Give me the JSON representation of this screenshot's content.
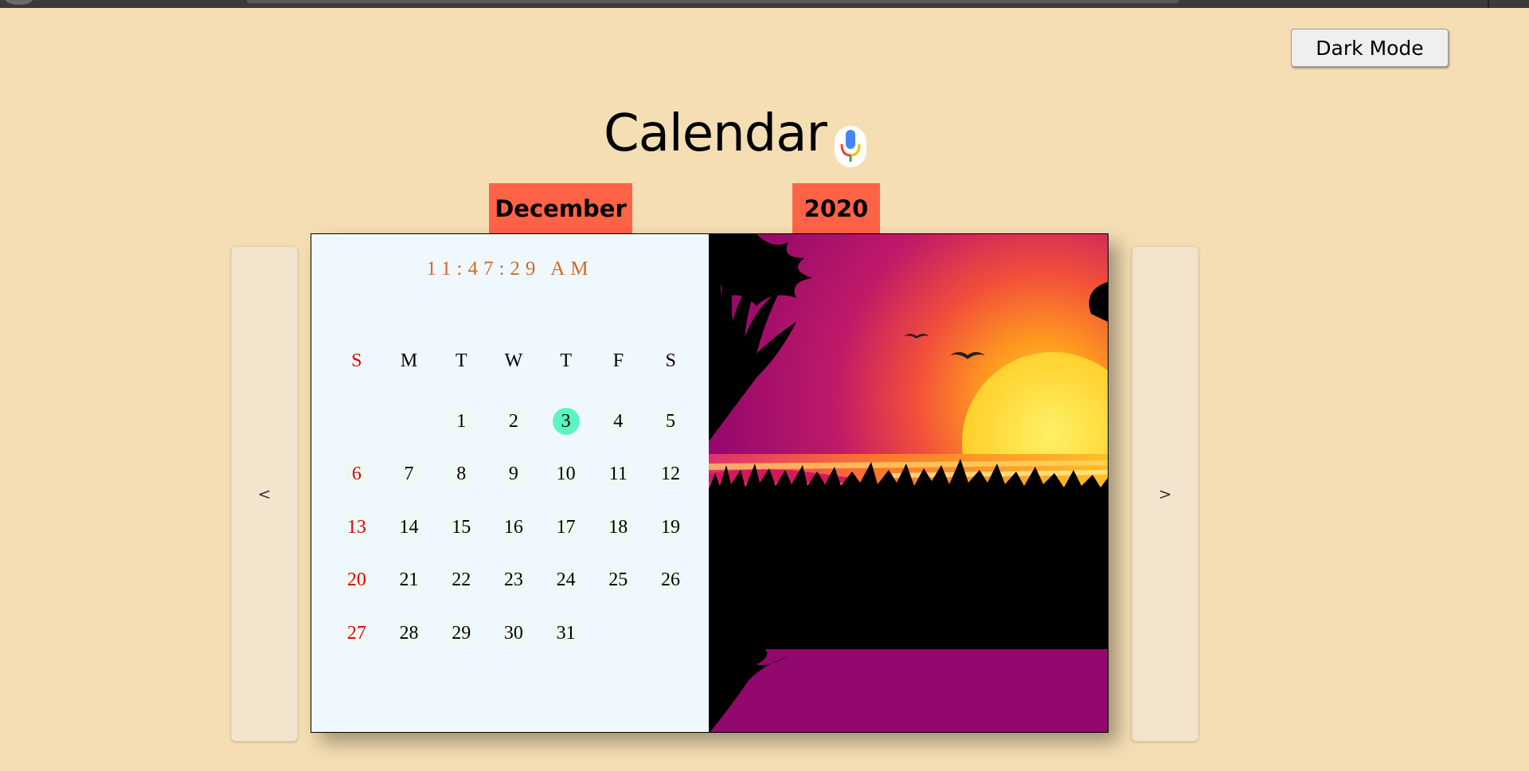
{
  "app": {
    "title": "Calendar",
    "dark_mode_label": "Dark Mode"
  },
  "header": {
    "month": "December",
    "year": "2020"
  },
  "clock": "11:47:29 AM",
  "nav": {
    "prev_label": "<",
    "next_label": ">"
  },
  "weekdays": [
    "S",
    "M",
    "T",
    "W",
    "T",
    "F",
    "S"
  ],
  "calendar": {
    "first_weekday_index": 2,
    "days_in_month": 31,
    "today": 3
  },
  "icons": {
    "mic": "microphone-icon",
    "scene": "sunset-palm-image"
  },
  "colors": {
    "background": "#f5deb3",
    "tab": "#ff6347",
    "clock": "#d2691e",
    "sunday": "#e00000",
    "today": "#5cf5c2",
    "calendar_panel": "#f0f8ff"
  }
}
